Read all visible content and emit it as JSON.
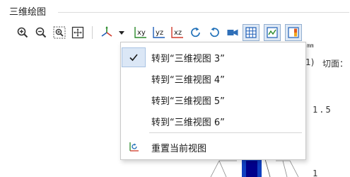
{
  "panel": {
    "title": "三维绘图"
  },
  "toolbar": {
    "buttons": [
      {
        "icon": "zoom-in-icon"
      },
      {
        "icon": "zoom-out-icon"
      },
      {
        "icon": "zoom-box-icon"
      },
      {
        "icon": "zoom-extents-icon"
      },
      {
        "icon": "axis-view-icon"
      },
      {
        "icon": "dropdown-arrow-icon"
      },
      {
        "icon": "view-xy-icon",
        "text": "xy"
      },
      {
        "icon": "view-yz-icon",
        "text": "yz"
      },
      {
        "icon": "view-xz-icon",
        "text": "xz"
      },
      {
        "icon": "rotate-right-icon"
      },
      {
        "icon": "rotate-left-icon"
      },
      {
        "icon": "camera-icon"
      },
      {
        "icon": "grid-icon"
      },
      {
        "icon": "graph-icon"
      },
      {
        "icon": "color-legend-icon"
      }
    ],
    "accent": "#1e6fb8"
  },
  "menu": {
    "items": [
      {
        "label": "转到“三维视图 3”",
        "checked": true
      },
      {
        "label": "转到“三维视图 4”",
        "checked": false
      },
      {
        "label": "转到“三维视图 5”",
        "checked": false
      },
      {
        "label": "转到“三维视图 6”",
        "checked": false
      }
    ],
    "reset": {
      "label": "重置当前视图",
      "icon": "reset-view-icon"
    },
    "check_icon": "checkmark-icon"
  },
  "plot": {
    "unit": "mm",
    "header_left": "1)",
    "header_right": "切面：",
    "tick_upper": "1.5",
    "tick_lower": "1",
    "colors": {
      "dark_blue": "#00008b",
      "blue": "#1040c0"
    }
  }
}
